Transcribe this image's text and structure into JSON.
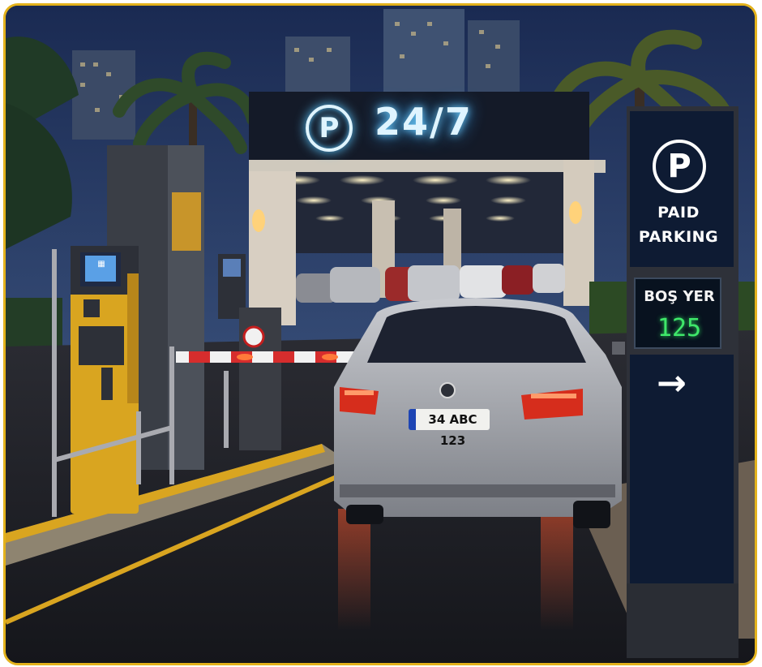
{
  "canopy": {
    "sign_text": "24/7",
    "parking_symbol": "P"
  },
  "pylon_sign": {
    "parking_symbol": "P",
    "line1": "PAID",
    "line2": "PARKING",
    "availability_label": "BOŞ YER",
    "availability_count": "125",
    "direction_icon": "arrow-right-icon"
  },
  "car": {
    "license_plate": "34 ABC 123"
  },
  "colors": {
    "frame_border": "#e3b21c",
    "neon_blue": "#6fd0ff",
    "kiosk_yellow": "#d9a520",
    "display_green": "#3fe86a",
    "sign_navy": "#0e1b33",
    "barrier_red": "#d62d2d"
  }
}
